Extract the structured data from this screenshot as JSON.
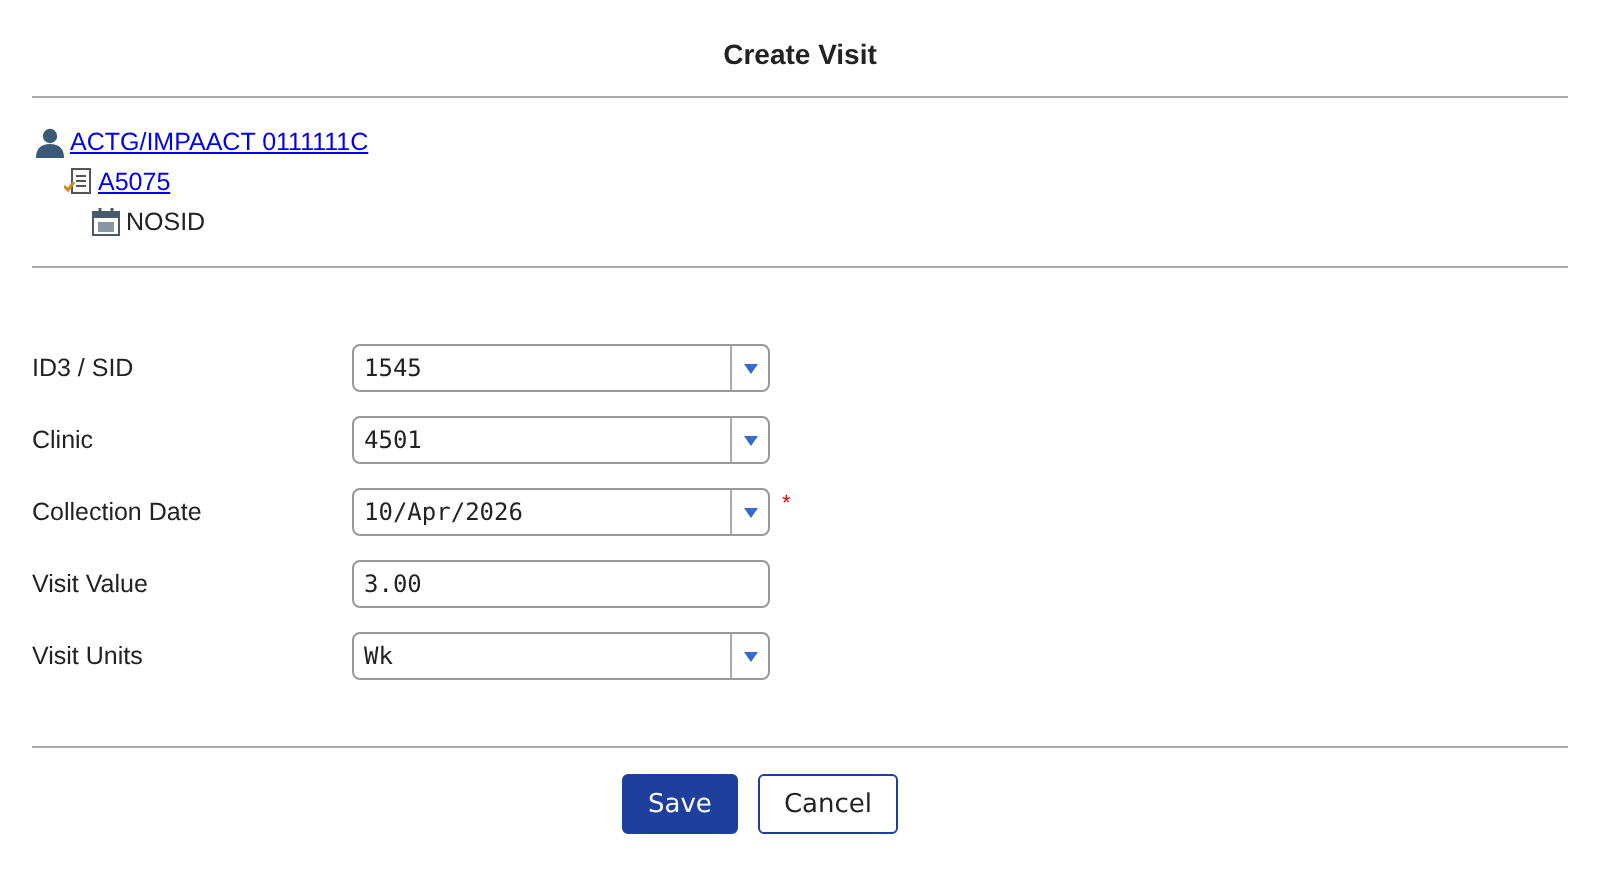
{
  "dialog": {
    "title": "Create Visit"
  },
  "tree": [
    {
      "label": "ACTG/IMPAACT 0111111C",
      "kind": "person",
      "link": true,
      "children": [
        {
          "label": "A5075",
          "kind": "protocol",
          "link": true,
          "children": [
            {
              "label": "NOSID",
              "kind": "calendar",
              "link": false
            }
          ]
        }
      ]
    }
  ],
  "fields": [
    {
      "label": "ID3 / SID",
      "kind": "dropdown",
      "value": "1545"
    },
    {
      "label": "Clinic",
      "kind": "dropdown",
      "value": "4501"
    },
    {
      "label": "Collection Date",
      "kind": "dropdown",
      "value": "10/Apr/2026",
      "required_mark": "*"
    },
    {
      "label": "Visit Value",
      "kind": "text",
      "value": "3.00"
    },
    {
      "label": "Visit Units",
      "kind": "dropdown",
      "value": "Wk"
    }
  ],
  "buttons": [
    {
      "label": "Save",
      "kind": "primary"
    },
    {
      "label": "Cancel",
      "kind": "secondary"
    }
  ]
}
